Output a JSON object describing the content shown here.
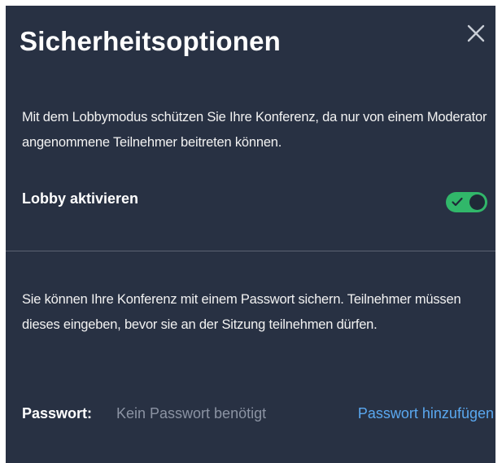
{
  "dialog": {
    "title": "Sicherheitsoptionen",
    "close_icon": "close-icon"
  },
  "lobby": {
    "description": "Mit dem Lobbymodus schützen Sie Ihre Konferenz, da nur von einem Moderator angenommene Teilnehmer beitreten können.",
    "label": "Lobby aktivieren",
    "toggle_on": true,
    "toggle_color": "#31b76a",
    "toggle_icon": "check-icon"
  },
  "password": {
    "description": "Sie können Ihre Konferenz mit einem Passwort sichern. Teilnehmer müssen dieses eingeben, bevor sie an der Sitzung teilnehmen dürfen.",
    "label": "Passwort:",
    "value": "Kein Passwort benötigt",
    "add_link": "Passwort hinzufügen",
    "link_color": "#5aa8f0"
  },
  "colors": {
    "background": "#283143",
    "divider": "#5b6373"
  }
}
